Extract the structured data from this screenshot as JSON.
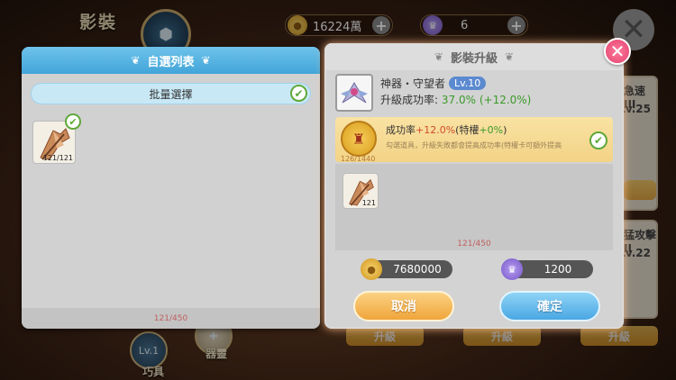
{
  "background": {
    "title": "影裝",
    "currency_gold": "16224萬",
    "currency_crystal": "6",
    "side_cards": [
      {
        "name": "急速 III",
        "level": "Lv.25"
      },
      {
        "name": "猛攻擊 II",
        "level": "Lv.22"
      }
    ],
    "upgrade_buttons": [
      "升級",
      "升級",
      "升級"
    ],
    "bottom_icons": [
      {
        "badge": "Lv.1",
        "label": "巧具"
      },
      {
        "label": "器靈"
      }
    ]
  },
  "left_panel": {
    "title": "自選列表",
    "batch_select_label": "批量選擇",
    "items": [
      {
        "count": "121/121",
        "selected": true
      }
    ],
    "footer_count": "121/450"
  },
  "right_panel": {
    "title": "影裝升級",
    "artifact_name": "神器・守望者",
    "artifact_level": "Lv.10",
    "success_label": "升級成功率:",
    "success_value": "37.0%",
    "success_bonus": "(+12.0%)",
    "bonus": {
      "title_prefix": "成功率",
      "title_value": "+12.0%",
      "title_privilege_prefix": "(特權",
      "title_privilege_value": "+0%",
      "title_suffix": ")",
      "count": "126/1440",
      "description": "勾選道具，升級失敗都會提高成功率(特權卡可額外提高"
    },
    "materials": [
      {
        "count": "121"
      }
    ],
    "material_footer": "121/450",
    "cost_gold": "7680000",
    "cost_crystal": "1200",
    "cancel_label": "取消",
    "confirm_label": "確定"
  },
  "colors": {
    "accent_blue": "#42a5d9",
    "accent_orange": "#f0a53a",
    "success_green": "#3b9a2a",
    "close_pink": "#e2426e"
  }
}
